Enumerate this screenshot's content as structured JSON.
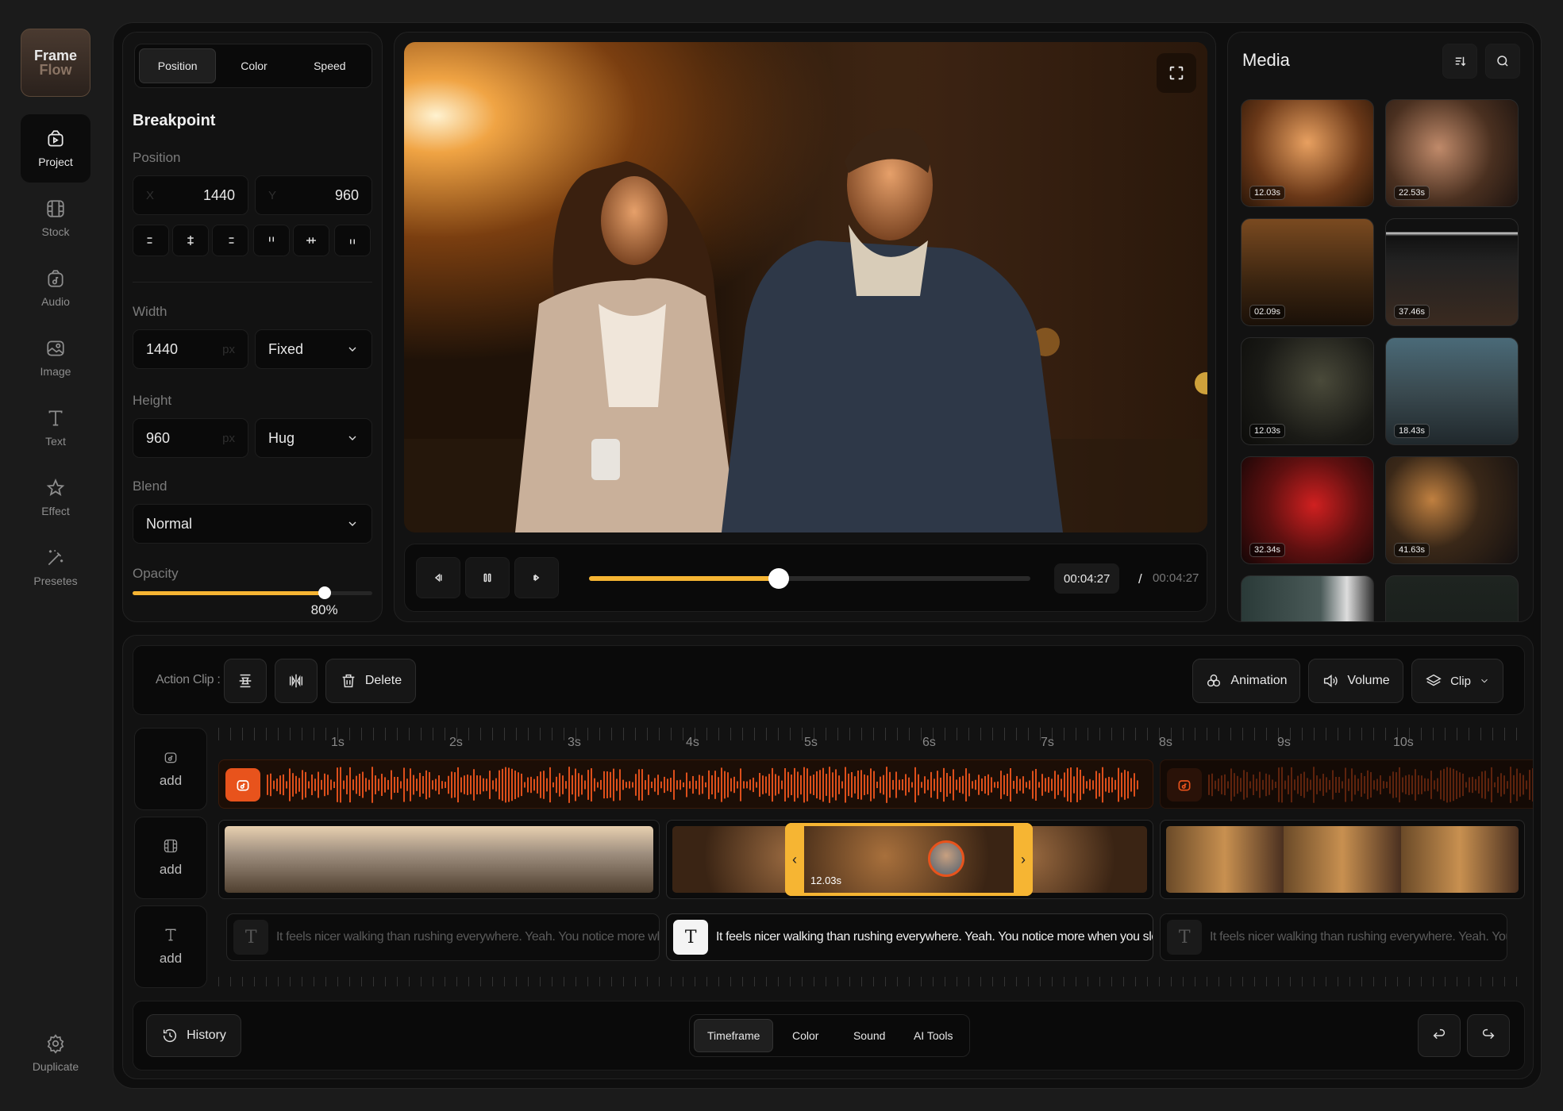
{
  "app": {
    "name_line1": "Frame",
    "name_line2": "Flow"
  },
  "sidebar": {
    "items": [
      {
        "label": "Project",
        "icon": "project-icon",
        "active": true
      },
      {
        "label": "Stock",
        "icon": "film-icon"
      },
      {
        "label": "Audio",
        "icon": "music-icon"
      },
      {
        "label": "Image",
        "icon": "image-icon"
      },
      {
        "label": "Text",
        "icon": "text-icon"
      },
      {
        "label": "Effect",
        "icon": "sparkle-icon"
      },
      {
        "label": "Presetes",
        "icon": "magic-wand-icon"
      }
    ],
    "bottom": {
      "label": "Duplicate",
      "icon": "gear-icon"
    }
  },
  "props": {
    "tabs": [
      "Position",
      "Color",
      "Speed"
    ],
    "active_tab": "Position",
    "heading": "Breakpoint",
    "position_label": "Position",
    "x_prefix": "X",
    "x_value": "1440",
    "y_prefix": "Y",
    "y_value": "960",
    "width_label": "Width",
    "width_value": "1440",
    "width_unit": "px",
    "width_mode": "Fixed",
    "height_label": "Height",
    "height_value": "960",
    "height_unit": "px",
    "height_mode": "Hug",
    "blend_label": "Blend",
    "blend_value": "Normal",
    "opacity_label": "Opacity",
    "opacity_value": "80%",
    "opacity_fraction": 0.8,
    "align_icons": [
      "align-left-icon",
      "align-center-h-icon",
      "align-right-icon",
      "align-top-icon",
      "align-center-v-icon",
      "align-bottom-icon"
    ]
  },
  "player": {
    "current_time": "00:04:27",
    "separator": "/",
    "total_time": "00:04:27",
    "progress_fraction": 0.43
  },
  "media": {
    "title": "Media",
    "items": [
      {
        "duration": "12.03s"
      },
      {
        "duration": "22.53s"
      },
      {
        "duration": "02.09s"
      },
      {
        "duration": "37.46s"
      },
      {
        "duration": "12.03s"
      },
      {
        "duration": "18.43s"
      },
      {
        "duration": "32.34s"
      },
      {
        "duration": "41.63s"
      }
    ]
  },
  "toolbar": {
    "action_label": "Action Clip :",
    "delete_label": "Delete",
    "animation_label": "Animation",
    "volume_label": "Volume",
    "clip_label": "Clip"
  },
  "timeline": {
    "ticks": [
      "1s",
      "2s",
      "3s",
      "4s",
      "5s",
      "6s",
      "7s",
      "8s",
      "9s",
      "10s"
    ],
    "add_label": "add",
    "selected_duration": "12.03s",
    "captions": [
      "It feels nicer walking than rushing everywhere. Yeah. You notice more when you slow down.",
      "It feels nicer walking than rushing everywhere. Yeah. You notice more when you slow down.",
      "It feels nicer walking than rushing everywhere. Yeah. You notice more when you slow down."
    ]
  },
  "bottom": {
    "history_label": "History",
    "tabs": [
      "Timeframe",
      "Color",
      "Sound",
      "AI Tools"
    ],
    "active_tab": "Timeframe"
  },
  "colors": {
    "accent": "#f6b533",
    "audio_orange": "#e8531c"
  }
}
